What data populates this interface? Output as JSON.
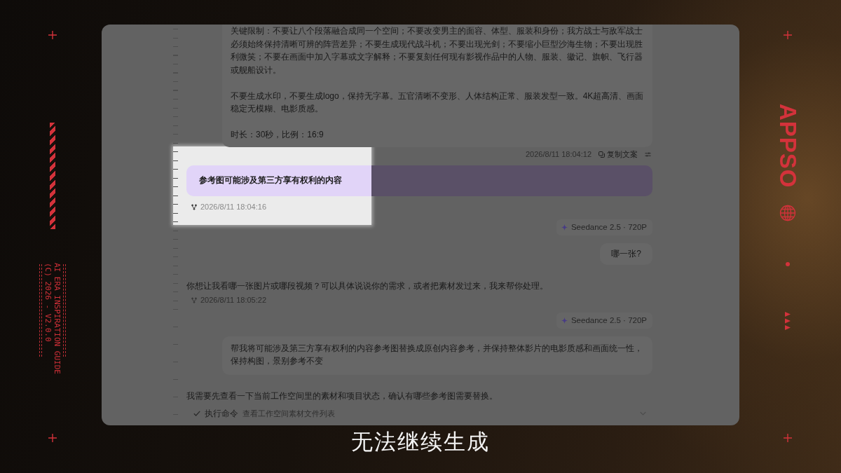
{
  "frame": {
    "guide_lines": [
      "AI ERA INSPIRATION GUIDE",
      "(C) 2026 - V2.0.0"
    ],
    "logo": "APPSO"
  },
  "chat": {
    "messages": [
      {
        "kind": "user",
        "paragraphs": [
          "关键限制：不要让八个段落融合成同一个空间；不要改变男主的面容、体型、服装和身份；我方战士与敌军战士必须始终保持清晰可辨的阵营差异；不要生成现代战斗机；不要出现光剑；不要缩小巨型沙海生物；不要出现胜利微笑；不要在画面中加入字幕或文字解释；不要复刻任何现有影视作品中的人物、服装、徽记、旗帜、飞行器或舰船设计。",
          "不要生成水印，不要生成logo，保持无字幕。五官清晰不变形、人体结构正常、服装发型一致。4K超高清、画面稳定无模糊、电影质感。",
          "时长：30秒，比例：16:9"
        ],
        "timestamp": "2026/8/11 18:04:12",
        "copy_label": "复制文案"
      },
      {
        "kind": "notice",
        "text": "参考图可能涉及第三方享有权利的内容",
        "timestamp": "2026/8/11 18:04:16",
        "spotlight": true
      },
      {
        "kind": "model_tag",
        "text": "Seedance 2.5 · 720P"
      },
      {
        "kind": "user",
        "paragraphs": [
          "哪一张?"
        ]
      },
      {
        "kind": "assistant",
        "text": "你想让我看哪一张图片或哪段视频？可以具体说说你的需求，或者把素材发过来，我来帮你处理。",
        "timestamp": "2026/8/11 18:05:22"
      },
      {
        "kind": "model_tag",
        "text": "Seedance 2.5 · 720P"
      },
      {
        "kind": "user",
        "paragraphs": [
          "帮我将可能涉及第三方享有权利的内容参考图替换成原创内容参考，并保持整体影片的电影质感和画面统一性，保持构图，景别参考不变"
        ]
      },
      {
        "kind": "assistant",
        "text": "我需要先查看一下当前工作空间里的素材和项目状态，确认有哪些参考图需要替换。"
      },
      {
        "kind": "tool_step",
        "label": "执行命令",
        "detail": "查看工作空间素材文件列表",
        "done": true,
        "expanded": false
      }
    ]
  },
  "subtitle": "无法继续生成"
}
